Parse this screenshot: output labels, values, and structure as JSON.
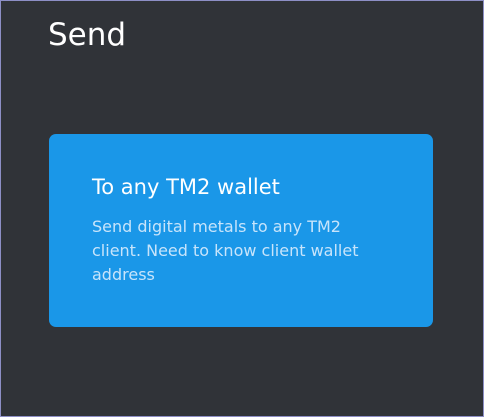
{
  "page": {
    "title": "Send"
  },
  "card": {
    "title": "To any TM2 wallet",
    "description": "Send digital metals to any TM2 client. Need to know client wallet address"
  },
  "colors": {
    "background": "#303338",
    "card": "#1a97e8",
    "frame_border": "#8d8fc6"
  }
}
